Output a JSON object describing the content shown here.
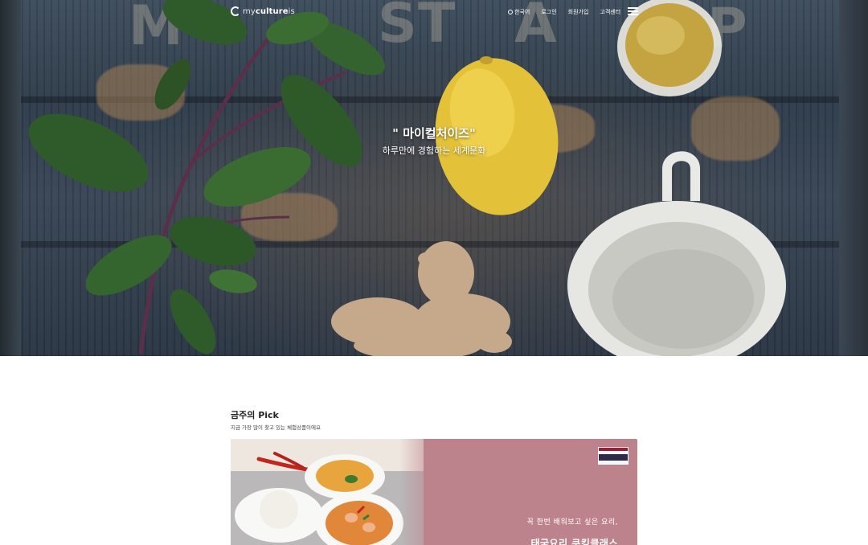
{
  "header": {
    "logo": {
      "prefix": "my",
      "main": "culture",
      "suffix": "is"
    },
    "nav": [
      {
        "label": "한국어",
        "icon": "globe-icon"
      },
      {
        "label": "로그인"
      },
      {
        "label": "회원가입"
      },
      {
        "label": "고객센터"
      }
    ],
    "menu_icon": "hamburger-menu-icon"
  },
  "hero": {
    "title": "\" 마이컬처이즈\"",
    "subtitle": "하루만에 경험하는 세계문화"
  },
  "pick": {
    "title": "금주의 Pick",
    "subtitle": "지금 가장 많이 찾고 있는 체험상품이에요",
    "card": {
      "accent_color": "#bd838c",
      "flag": {
        "name": "thailand-flag-icon",
        "colors": [
          "#a51931",
          "#f4f5f8",
          "#2d2a4a",
          "#f4f5f8",
          "#a51931"
        ]
      },
      "line1": "꼭 한번 배워보고 싶은 요리,",
      "line2": "태국요리 쿠킹클래스"
    }
  }
}
